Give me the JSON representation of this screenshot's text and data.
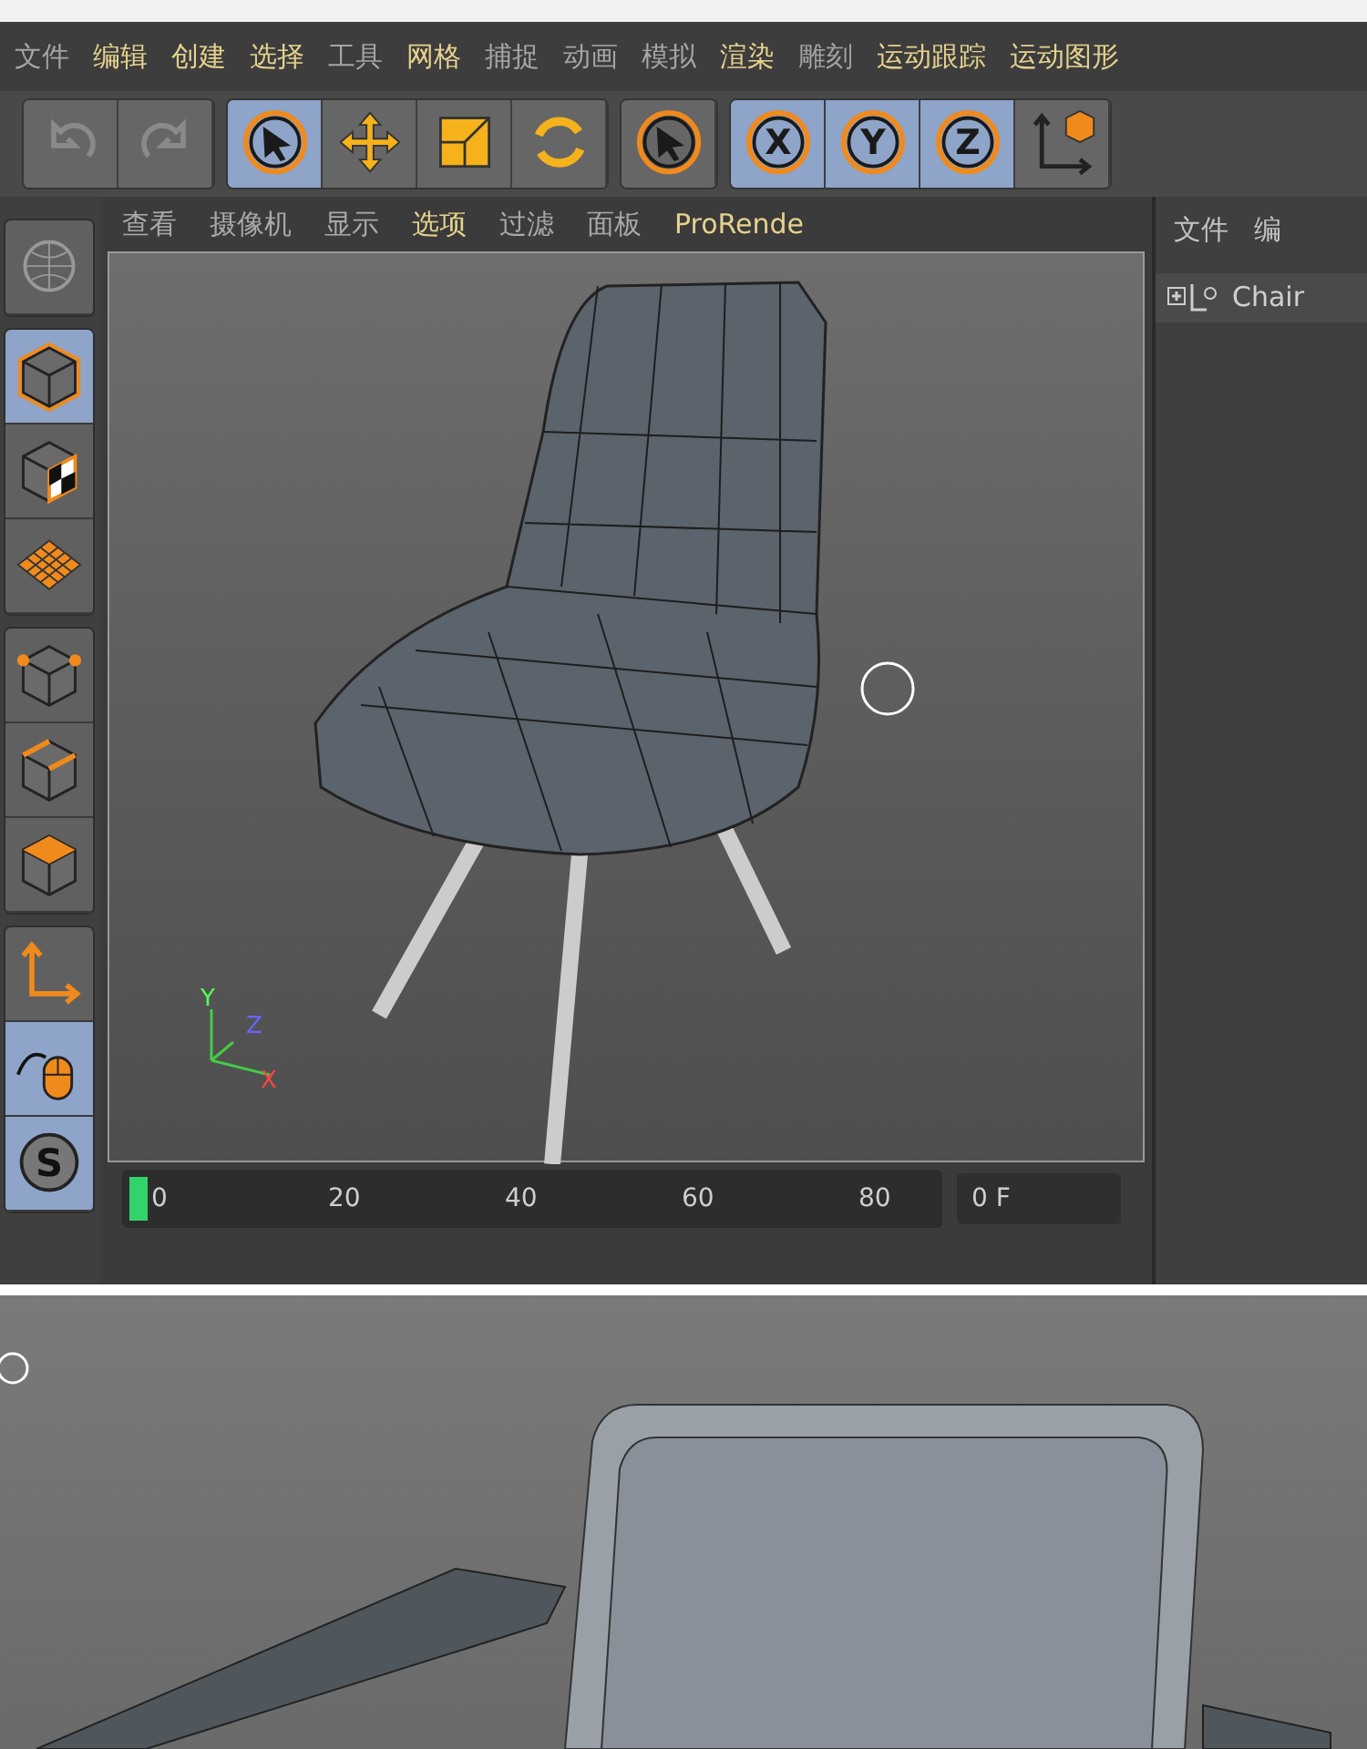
{
  "menu": [
    {
      "label": "文件",
      "dimmed": true
    },
    {
      "label": "编辑",
      "dimmed": false
    },
    {
      "label": "创建",
      "dimmed": false
    },
    {
      "label": "选择",
      "dimmed": false
    },
    {
      "label": "工具",
      "dimmed": true
    },
    {
      "label": "网格",
      "dimmed": false
    },
    {
      "label": "捕捉",
      "dimmed": true
    },
    {
      "label": "动画",
      "dimmed": true
    },
    {
      "label": "模拟",
      "dimmed": true
    },
    {
      "label": "渲染",
      "dimmed": false
    },
    {
      "label": "雕刻",
      "dimmed": true
    },
    {
      "label": "运动跟踪",
      "dimmed": false
    },
    {
      "label": "运动图形",
      "dimmed": false
    }
  ],
  "toolbar": [
    [
      {
        "kind": "undo",
        "selected": false,
        "disabled": true
      },
      {
        "kind": "redo",
        "selected": false,
        "disabled": true
      }
    ],
    [
      {
        "kind": "select",
        "selected": true,
        "disabled": false
      },
      {
        "kind": "move",
        "selected": false,
        "disabled": false
      },
      {
        "kind": "scale",
        "selected": false,
        "disabled": false
      },
      {
        "kind": "rotate",
        "selected": false,
        "disabled": false
      }
    ],
    [
      {
        "kind": "select",
        "selected": false,
        "disabled": false
      }
    ],
    [
      {
        "kind": "x",
        "label": "X",
        "selected": true,
        "disabled": false
      },
      {
        "kind": "y",
        "label": "Y",
        "selected": true,
        "disabled": false
      },
      {
        "kind": "z",
        "label": "Z",
        "selected": true,
        "disabled": false
      },
      {
        "kind": "coord",
        "selected": false,
        "disabled": false
      }
    ]
  ],
  "object_panel": {
    "tabs": [
      "文件",
      "编"
    ],
    "items": [
      {
        "label": "Chair"
      }
    ]
  },
  "viewport": {
    "menu": [
      {
        "label": "查看",
        "dimmed": true
      },
      {
        "label": "摄像机",
        "dimmed": true
      },
      {
        "label": "显示",
        "dimmed": true
      },
      {
        "label": "选项",
        "dimmed": false
      },
      {
        "label": "过滤",
        "dimmed": true
      },
      {
        "label": "面板",
        "dimmed": true
      },
      {
        "label": "ProRende",
        "dimmed": false
      }
    ],
    "axes": [
      "Y",
      "Z",
      "X"
    ]
  },
  "side_tools": [
    [
      {
        "kind": "globe",
        "selected": false
      }
    ],
    [
      {
        "kind": "model",
        "selected": true
      },
      {
        "kind": "texture",
        "selected": false
      },
      {
        "kind": "workplane",
        "selected": false
      }
    ],
    [
      {
        "kind": "points",
        "selected": false
      },
      {
        "kind": "edges",
        "selected": false
      },
      {
        "kind": "polygons",
        "selected": false
      }
    ],
    [
      {
        "kind": "axis",
        "selected": false
      },
      {
        "kind": "tweak",
        "selected": true
      },
      {
        "kind": "snap",
        "label": "S",
        "selected": true
      }
    ]
  ],
  "timeline": {
    "ticks": [
      "0",
      "20",
      "40",
      "60",
      "80"
    ],
    "frame": "0 F",
    "level": 0.0
  }
}
